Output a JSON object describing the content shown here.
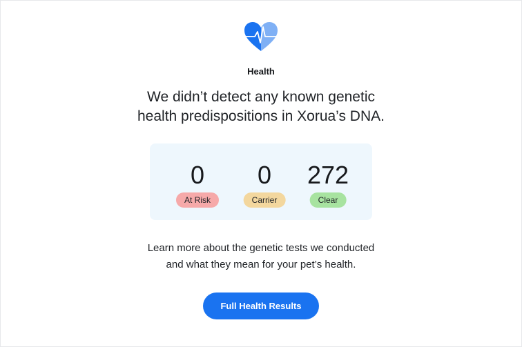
{
  "section": {
    "icon": "heart-pulse-icon",
    "label": "Health"
  },
  "headline": {
    "line1": "We didn’t detect any known genetic",
    "line2": "health predispositions in Xorua’s DNA."
  },
  "stats": [
    {
      "value": "0",
      "label": "At Risk",
      "badge_color": "#f6a9a9"
    },
    {
      "value": "0",
      "label": "Carrier",
      "badge_color": "#f3d79e"
    },
    {
      "value": "272",
      "label": "Clear",
      "badge_color": "#a7e3a0"
    }
  ],
  "description": {
    "line1": "Learn more about the genetic tests we conducted",
    "line2": "and what they mean for your pet’s health."
  },
  "cta": {
    "label": "Full Health Results",
    "color": "#1a73f0"
  },
  "colors": {
    "stats_card_bg": "#eef7fd",
    "heart_primary": "#1a73f0",
    "heart_secondary": "#7fb0f5"
  }
}
